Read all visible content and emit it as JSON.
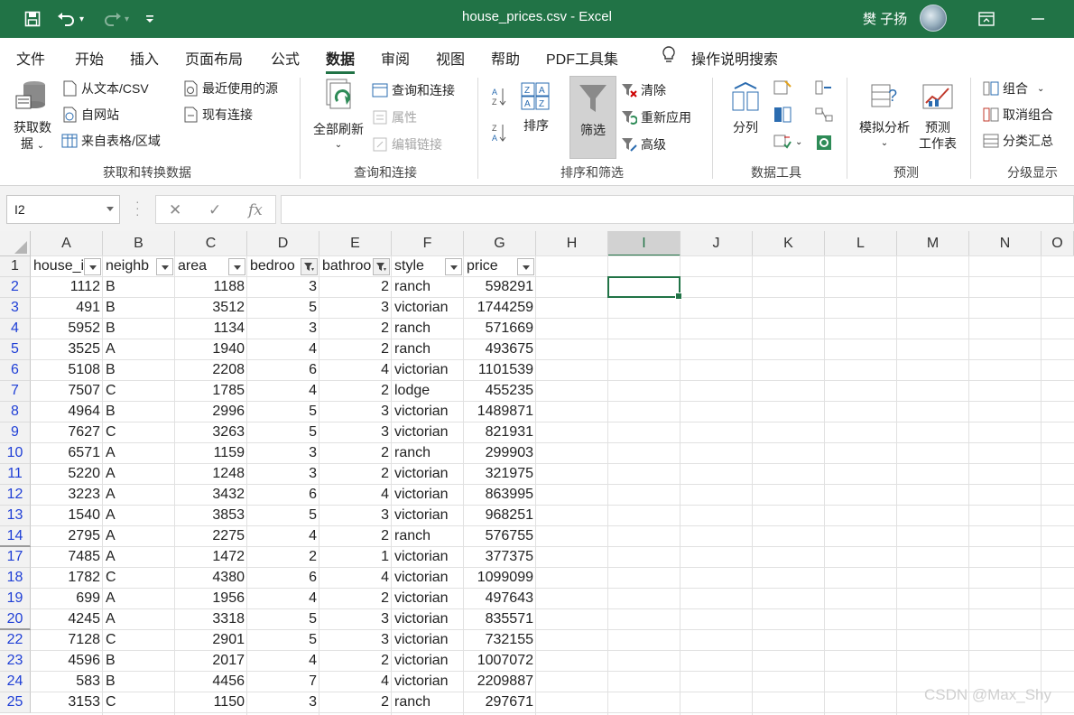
{
  "window": {
    "title": "house_prices.csv  -  Excel",
    "user": "樊 子扬"
  },
  "tabs": [
    "文件",
    "开始",
    "插入",
    "页面布局",
    "公式",
    "数据",
    "审阅",
    "视图",
    "帮助",
    "PDF工具集",
    "操作说明搜索"
  ],
  "ribbon": {
    "get_data": {
      "big": "获取数",
      "big2": "据",
      "from_text": "从文本/CSV",
      "from_web": "自网站",
      "from_table": "来自表格/区域",
      "recent": "最近使用的源",
      "existing": "现有连接",
      "label": "获取和转换数据"
    },
    "queries": {
      "refresh_all": "全部刷新",
      "queries_conn": "查询和连接",
      "properties": "属性",
      "edit_links": "编辑链接",
      "label": "查询和连接"
    },
    "sort_filter": {
      "sort": "排序",
      "filter": "筛选",
      "clear": "清除",
      "reapply": "重新应用",
      "advanced": "高级",
      "label": "排序和筛选"
    },
    "data_tools": {
      "text_to_cols": "分列",
      "label": "数据工具"
    },
    "forecast": {
      "whatif": "模拟分析",
      "forecast_sheet": "预测",
      "forecast_sheet2": "工作表",
      "label": "预测"
    },
    "outline": {
      "group": "组合",
      "ungroup": "取消组合",
      "subtotal": "分类汇总",
      "label": "分级显示"
    }
  },
  "formula_bar": {
    "name_box": "I2",
    "fx": "fx",
    "formula": ""
  },
  "sheet": {
    "columns": [
      "A",
      "B",
      "C",
      "D",
      "E",
      "F",
      "G",
      "H",
      "I",
      "J",
      "K",
      "L",
      "M",
      "N",
      "O"
    ],
    "selected_column": "I",
    "headers": [
      "house_id",
      "neighborhood",
      "area",
      "bedrooms",
      "bathrooms",
      "style",
      "price"
    ],
    "header_display": [
      "house_i",
      "neighb",
      "area",
      "bedroo",
      "bathroo",
      "style",
      "price"
    ],
    "filtered_columns": [
      "D",
      "E"
    ],
    "rows": [
      {
        "n": "2",
        "cells": [
          "1112",
          "B",
          "1188",
          "3",
          "2",
          "ranch",
          "598291"
        ]
      },
      {
        "n": "3",
        "cells": [
          "491",
          "B",
          "3512",
          "5",
          "3",
          "victorian",
          "1744259"
        ]
      },
      {
        "n": "4",
        "cells": [
          "5952",
          "B",
          "1134",
          "3",
          "2",
          "ranch",
          "571669"
        ]
      },
      {
        "n": "5",
        "cells": [
          "3525",
          "A",
          "1940",
          "4",
          "2",
          "ranch",
          "493675"
        ]
      },
      {
        "n": "6",
        "cells": [
          "5108",
          "B",
          "2208",
          "6",
          "4",
          "victorian",
          "1101539"
        ]
      },
      {
        "n": "7",
        "cells": [
          "7507",
          "C",
          "1785",
          "4",
          "2",
          "lodge",
          "455235"
        ]
      },
      {
        "n": "8",
        "cells": [
          "4964",
          "B",
          "2996",
          "5",
          "3",
          "victorian",
          "1489871"
        ]
      },
      {
        "n": "9",
        "cells": [
          "7627",
          "C",
          "3263",
          "5",
          "3",
          "victorian",
          "821931"
        ]
      },
      {
        "n": "10",
        "cells": [
          "6571",
          "A",
          "1159",
          "3",
          "2",
          "ranch",
          "299903"
        ]
      },
      {
        "n": "11",
        "cells": [
          "5220",
          "A",
          "1248",
          "3",
          "2",
          "victorian",
          "321975"
        ]
      },
      {
        "n": "12",
        "cells": [
          "3223",
          "A",
          "3432",
          "6",
          "4",
          "victorian",
          "863995"
        ]
      },
      {
        "n": "13",
        "cells": [
          "1540",
          "A",
          "3853",
          "5",
          "3",
          "victorian",
          "968251"
        ]
      },
      {
        "n": "14",
        "cells": [
          "2795",
          "A",
          "2275",
          "4",
          "2",
          "ranch",
          "576755"
        ]
      },
      {
        "n": "17",
        "cells": [
          "7485",
          "A",
          "1472",
          "2",
          "1",
          "victorian",
          "377375"
        ]
      },
      {
        "n": "18",
        "cells": [
          "1782",
          "C",
          "4380",
          "6",
          "4",
          "victorian",
          "1099099"
        ]
      },
      {
        "n": "19",
        "cells": [
          "699",
          "A",
          "1956",
          "4",
          "2",
          "victorian",
          "497643"
        ]
      },
      {
        "n": "20",
        "cells": [
          "4245",
          "A",
          "3318",
          "5",
          "3",
          "victorian",
          "835571"
        ]
      },
      {
        "n": "22",
        "cells": [
          "7128",
          "C",
          "2901",
          "5",
          "3",
          "victorian",
          "732155"
        ]
      },
      {
        "n": "23",
        "cells": [
          "4596",
          "B",
          "2017",
          "4",
          "2",
          "victorian",
          "1007072"
        ]
      },
      {
        "n": "24",
        "cells": [
          "583",
          "B",
          "4456",
          "7",
          "4",
          "victorian",
          "2209887"
        ]
      },
      {
        "n": "25",
        "cells": [
          "3153",
          "C",
          "1150",
          "3",
          "2",
          "ranch",
          "297671"
        ]
      }
    ]
  },
  "watermark": "CSDN @Max_Shy",
  "colors": {
    "excel_green": "#217346",
    "filtered_row_number": "#1f3fd6"
  }
}
